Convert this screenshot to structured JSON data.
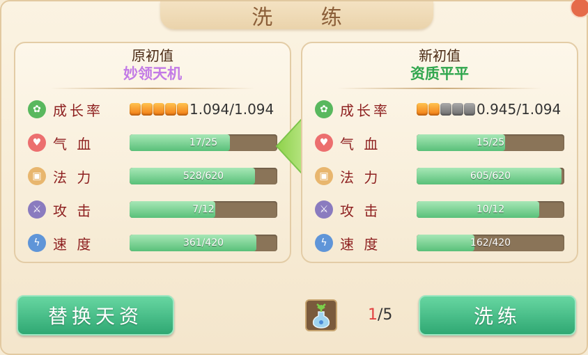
{
  "title": "洗 练",
  "left_panel": {
    "caption": "原初值",
    "aptitude": "妙领天机",
    "growth": {
      "label": "成长率",
      "gems_on": 5,
      "gems_total": 5,
      "text": "1.094/1.094"
    },
    "stats": [
      {
        "icon": "heart-icon",
        "label": "气 血",
        "text": "17/25",
        "fraction": 0.68
      },
      {
        "icon": "scroll-icon",
        "label": "法 力",
        "text": "528/620",
        "fraction": 0.85
      },
      {
        "icon": "sword-icon",
        "label": "攻 击",
        "text": "7/12",
        "fraction": 0.58
      },
      {
        "icon": "lightning-icon",
        "label": "速 度",
        "text": "361/420",
        "fraction": 0.86
      }
    ]
  },
  "right_panel": {
    "caption": "新初值",
    "aptitude": "资质平平",
    "growth": {
      "label": "成长率",
      "gems_on": 2,
      "gems_total": 5,
      "text": "0.945/1.094"
    },
    "stats": [
      {
        "icon": "heart-icon",
        "label": "气 血",
        "text": "15/25",
        "fraction": 0.6
      },
      {
        "icon": "scroll-icon",
        "label": "法 力",
        "text": "605/620",
        "fraction": 0.98
      },
      {
        "icon": "sword-icon",
        "label": "攻 击",
        "text": "10/12",
        "fraction": 0.83
      },
      {
        "icon": "lightning-icon",
        "label": "速 度",
        "text": "162/420",
        "fraction": 0.39
      }
    ]
  },
  "buttons": {
    "replace": "替换天资",
    "wash": "洗练"
  },
  "counter": {
    "current": "1",
    "total": "/5"
  },
  "colors": {
    "accent_green": "#2fa873",
    "aptitude_purple": "#c27ae6",
    "aptitude_green": "#2fa64d",
    "label_red": "#8d1f1f"
  }
}
